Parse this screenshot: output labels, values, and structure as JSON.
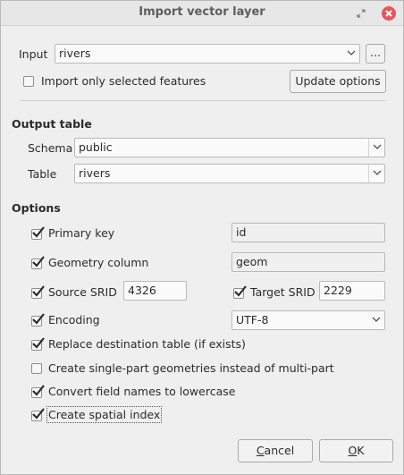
{
  "window": {
    "title": "Import vector layer",
    "colors": {
      "close": "#e8555d",
      "accent": "#2b2b2b"
    }
  },
  "input": {
    "label": "Input",
    "value": "rivers",
    "browse_label": "...",
    "only_selected_label": "Import only selected features",
    "only_selected_checked": false,
    "update_label": "Update options"
  },
  "output": {
    "heading": "Output table",
    "schema_label": "Schema",
    "schema_value": "public",
    "table_label": "Table",
    "table_value": "rivers"
  },
  "options": {
    "heading": "Options",
    "primary_key": {
      "label": "Primary key",
      "checked": true,
      "value": "id"
    },
    "geometry_column": {
      "label": "Geometry column",
      "checked": true,
      "value": "geom"
    },
    "source_srid": {
      "label": "Source SRID",
      "checked": true,
      "value": "4326"
    },
    "target_srid": {
      "label": "Target SRID",
      "checked": true,
      "value": "2229"
    },
    "encoding": {
      "label": "Encoding",
      "checked": true,
      "value": "UTF-8"
    },
    "replace_table": {
      "label": "Replace destination table (if exists)",
      "checked": true
    },
    "single_part": {
      "label": "Create single-part geometries instead of multi-part",
      "checked": false
    },
    "lowercase": {
      "label": "Convert field names to lowercase",
      "checked": true
    },
    "spatial_index": {
      "label": "Create spatial index",
      "checked": true
    }
  },
  "buttons": {
    "cancel": {
      "mnemonic": "C",
      "rest": "ancel"
    },
    "ok": {
      "mnemonic": "O",
      "rest": "K"
    }
  }
}
